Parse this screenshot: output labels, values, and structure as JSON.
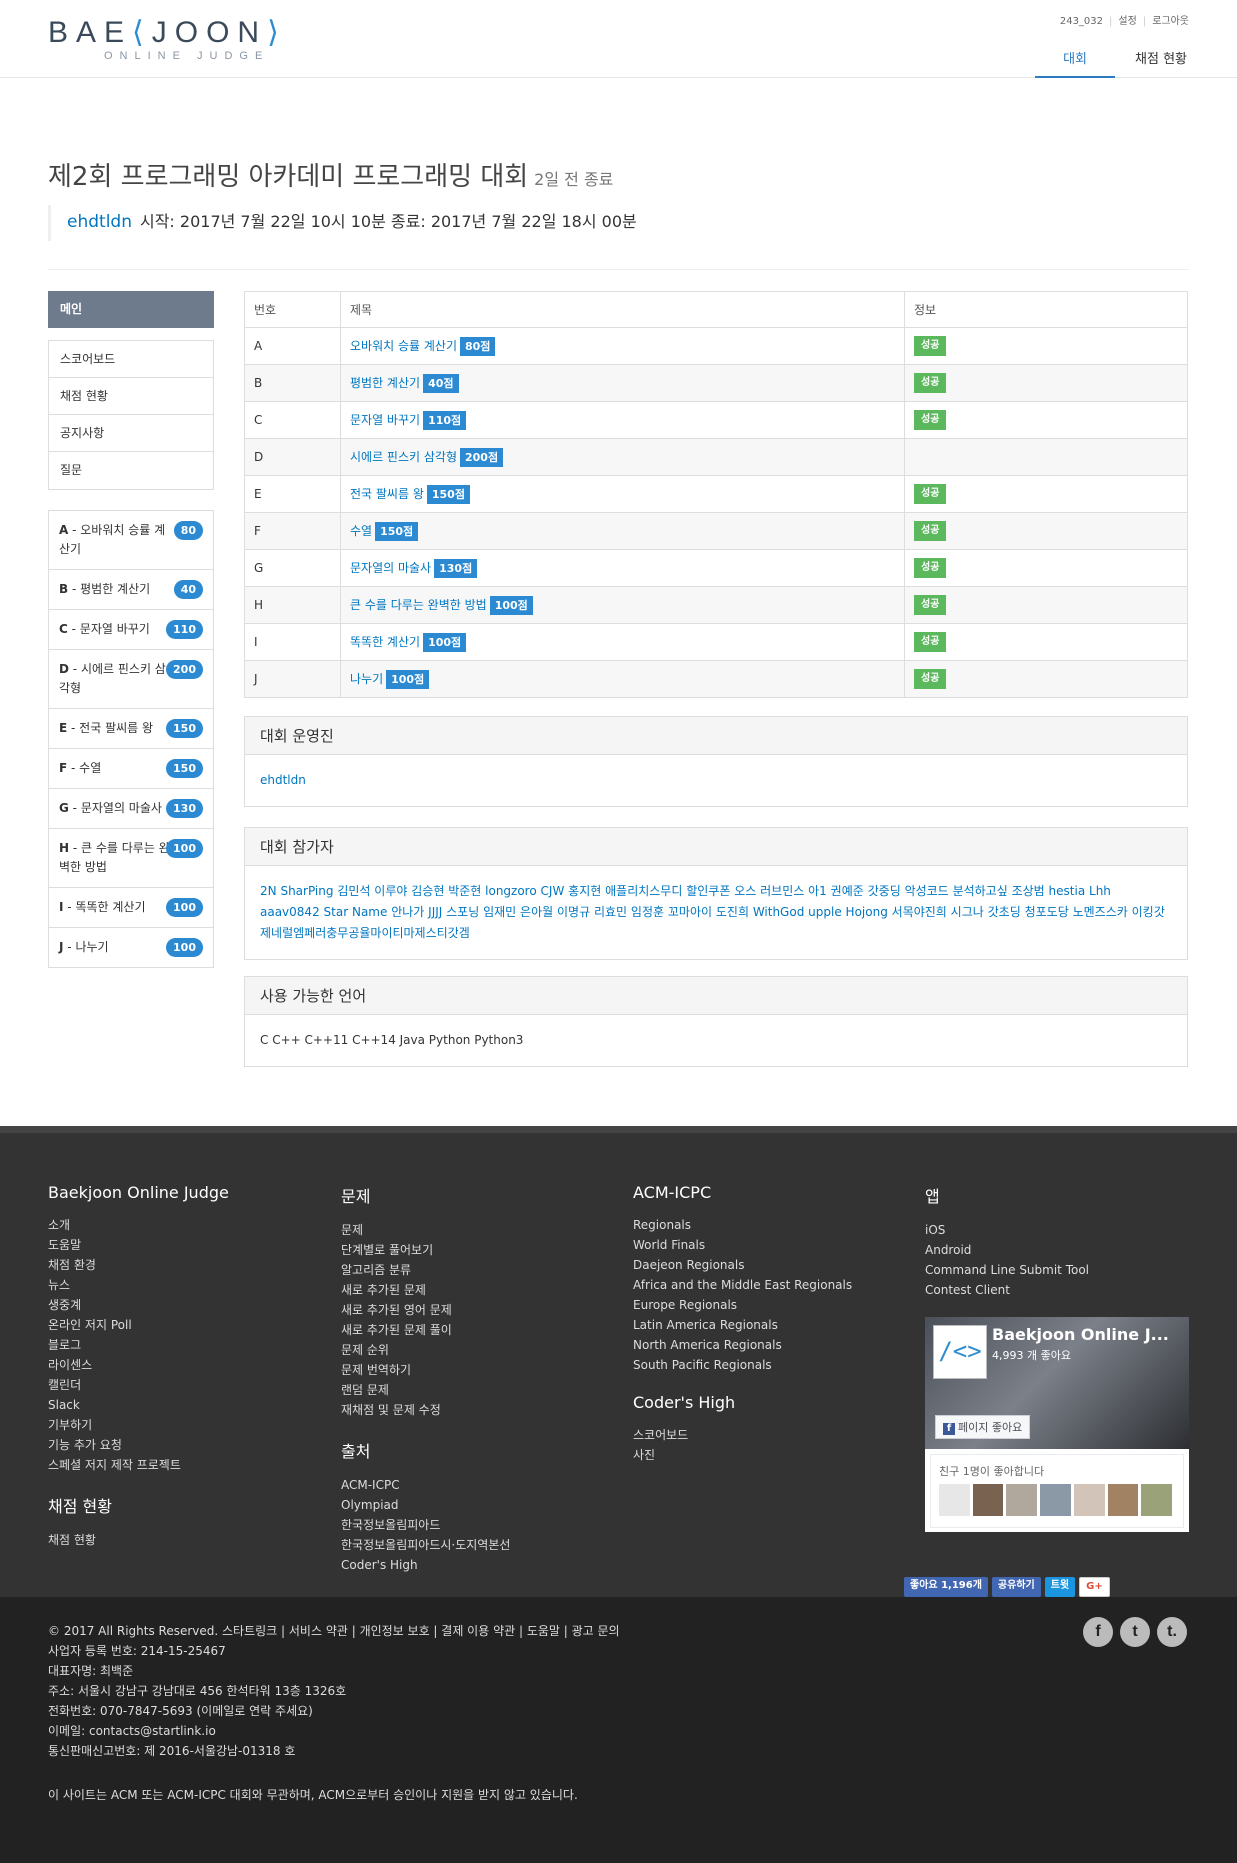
{
  "header": {
    "logo_main_1": "BAE",
    "logo_main_2": "⟨",
    "logo_main_3": "JOON",
    "logo_main_4": "⟩",
    "logo_sub": "ONLINE JUDGE",
    "user": "243_032",
    "settings": "설정",
    "logout": "로그아웃",
    "nav": [
      "대회",
      "채점 현황"
    ]
  },
  "contest": {
    "title": "제2회 프로그래밍 아카데미 프로그래밍 대회",
    "status": "2일 전 종료",
    "owner": "ehdtldn",
    "time": "시작: 2017년 7월 22일 10시 10분  종료: 2017년 7월 22일 18시 00분"
  },
  "sidebar": {
    "main": "메인",
    "links": [
      "스코어보드",
      "채점 현황",
      "공지사항",
      "질문"
    ],
    "problems": [
      {
        "id": "A",
        "name": "오바워치 승률 계산기",
        "score": "80"
      },
      {
        "id": "B",
        "name": "평범한 계산기",
        "score": "40"
      },
      {
        "id": "C",
        "name": "문자열 바꾸기",
        "score": "110"
      },
      {
        "id": "D",
        "name": "시에르 핀스키 삼각형",
        "score": "200"
      },
      {
        "id": "E",
        "name": "전국 팔씨름 왕",
        "score": "150"
      },
      {
        "id": "F",
        "name": "수열",
        "score": "150"
      },
      {
        "id": "G",
        "name": "문자열의 마술사",
        "score": "130"
      },
      {
        "id": "H",
        "name": "큰 수를 다루는 완벽한 방법",
        "score": "100"
      },
      {
        "id": "I",
        "name": "똑똑한 계산기",
        "score": "100"
      },
      {
        "id": "J",
        "name": "나누기",
        "score": "100"
      }
    ]
  },
  "table": {
    "headers": [
      "번호",
      "제목",
      "정보"
    ],
    "rows": [
      {
        "id": "A",
        "title": "오바워치 승률 계산기",
        "score": "80점",
        "info": "성공"
      },
      {
        "id": "B",
        "title": "평범한 계산기",
        "score": "40점",
        "info": "성공"
      },
      {
        "id": "C",
        "title": "문자열 바꾸기",
        "score": "110점",
        "info": "성공"
      },
      {
        "id": "D",
        "title": "시에르 핀스키 삼각형",
        "score": "200점",
        "info": ""
      },
      {
        "id": "E",
        "title": "전국 팔씨름 왕",
        "score": "150점",
        "info": "성공"
      },
      {
        "id": "F",
        "title": "수열",
        "score": "150점",
        "info": "성공"
      },
      {
        "id": "G",
        "title": "문자열의 마술사",
        "score": "130점",
        "info": "성공"
      },
      {
        "id": "H",
        "title": "큰 수를 다루는 완벽한 방법",
        "score": "100점",
        "info": "성공"
      },
      {
        "id": "I",
        "title": "똑똑한 계산기",
        "score": "100점",
        "info": "성공"
      },
      {
        "id": "J",
        "title": "나누기",
        "score": "100점",
        "info": "성공"
      }
    ]
  },
  "panels": {
    "staff_title": "대회 운영진",
    "staff": "ehdtldn",
    "participants_title": "대회 참가자",
    "participants": [
      "2N",
      "SharPing",
      "김민석",
      "이루야",
      "김승현",
      "박준현",
      "longzoro",
      "CJW",
      "홍지현",
      "애플리치스무디",
      "할인쿠폰",
      "오스",
      "러브민스",
      "아1",
      "권예준",
      "갓중딩",
      "악성코드",
      "분석하고싶",
      "조상범",
      "hestia",
      "Lhh",
      "aaav0842",
      "Star",
      "Name",
      "안나가",
      "JJJJ",
      "스포닝",
      "임재민",
      "은아월",
      "이명규",
      "리효민",
      "임정훈",
      "꼬마아이",
      "도진희",
      "WithGod",
      "upple",
      "Hojong",
      "서목야진희",
      "시그나",
      "갓초딩",
      "청포도당",
      "노멘즈스카",
      "이킹갓제네럴엠페러충무공율마이티마제스티갓겜"
    ],
    "lang_title": "사용 가능한 언어",
    "languages": "C C++ C++11 C++14 Java Python Python3"
  },
  "footer": {
    "col1_title": "Baekjoon Online Judge",
    "col1": [
      "소개",
      "도움말",
      "채점 환경",
      "뉴스",
      "생중계",
      "온라인 저지 Poll",
      "블로그",
      "라이센스",
      "캘린더",
      "Slack",
      "기부하기",
      "기능 추가 요청",
      "스페셜 저지 제작 프로젝트"
    ],
    "col1b_title": "채점 현황",
    "col1b": [
      "채점 현황"
    ],
    "col2_title": "문제",
    "col2": [
      "문제",
      "단계별로 풀어보기",
      "알고리즘 분류",
      "새로 추가된 문제",
      "새로 추가된 영어 문제",
      "새로 추가된 문제 풀이",
      "문제 순위",
      "문제 번역하기",
      "랜덤 문제",
      "재채점 및 문제 수정"
    ],
    "col2b_title": "출처",
    "col2b": [
      "ACM-ICPC",
      "Olympiad",
      "한국정보올림피아드",
      "한국정보올림피아드시·도지역본선",
      "Coder's High"
    ],
    "col3_title": "ACM-ICPC",
    "col3": [
      "Regionals",
      "World Finals",
      "Daejeon Regionals",
      "Africa and the Middle East Regionals",
      "Europe Regionals",
      "Latin America Regionals",
      "North America Regionals",
      "South Pacific Regionals"
    ],
    "col3b_title": "Coder's High",
    "col3b": [
      "스코어보드",
      "사진"
    ],
    "col4_title": "앱",
    "col4": [
      "iOS",
      "Android",
      "Command Line Submit Tool",
      "Contest Client"
    ],
    "fb": {
      "logo": "/<>",
      "name": "Baekjoon Online J...",
      "count": "4,993 개 좋아요",
      "button": "페이지 좋아요",
      "friends": "친구 1명이 좋아합니다"
    },
    "share": {
      "like": "좋아요 1,196개",
      "share": "공유하기",
      "tweet": "트윗",
      "gplus": "G+"
    }
  },
  "bottom": {
    "line1": "© 2017 All Rights Reserved. 스타트링크 | 서비스 약관 | 개인정보 보호 | 결제 이용 약관 | 도움말 | 광고 문의",
    "line2": "사업자 등록 번호: 214-15-25467",
    "line3": "대표자명: 최백준",
    "line4": "주소: 서울시 강남구 강남대로 456 한석타워 13층 1326호",
    "line5": "전화번호: 070-7847-5693 (이메일로 연락 주세요)",
    "line6": "이메일: contacts@startlink.io",
    "line7": "통신판매신고번호: 제 2016-서울강남-01318 호",
    "note": "이 사이트는 ACM 또는 ACM-ICPC 대회와 무관하며, ACM으로부터 승인이나 지원을 받지 않고 있습니다.",
    "social": [
      "f",
      "t",
      "t."
    ]
  },
  "colors": {
    "accent": "#2b8ad2",
    "success": "#5cb85c",
    "footer": "#333333"
  }
}
